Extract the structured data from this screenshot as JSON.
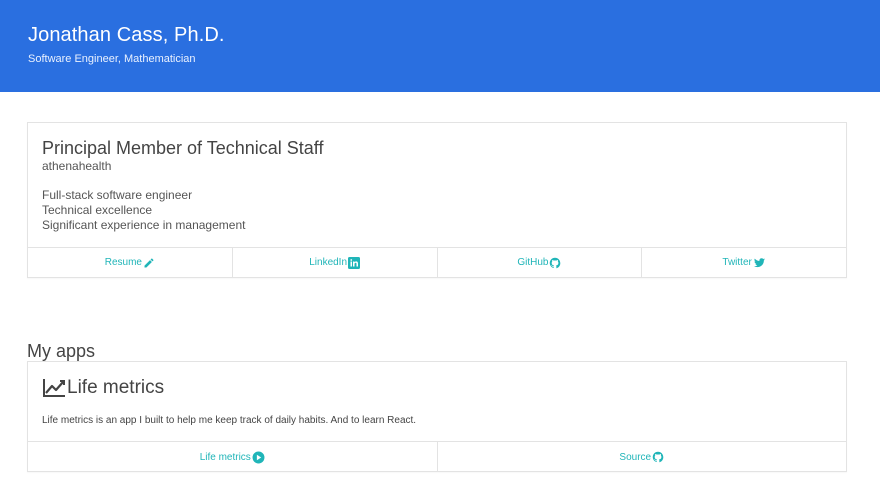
{
  "header": {
    "name": "Jonathan Cass, Ph.D.",
    "subtitle": "Software Engineer, Mathematician",
    "background": "#2a6fe0"
  },
  "job": {
    "title": "Principal Member of Technical Staff",
    "company": "athenahealth",
    "points": [
      "Full-stack software engineer",
      "Technical excellence",
      "Significant experience in management"
    ],
    "links": [
      {
        "label": "Resume",
        "icon": "pencil-icon"
      },
      {
        "label": "LinkedIn",
        "icon": "linkedin-icon"
      },
      {
        "label": "GitHub",
        "icon": "github-icon"
      },
      {
        "label": "Twitter",
        "icon": "twitter-icon"
      }
    ]
  },
  "apps": {
    "section_title": "My apps",
    "items": [
      {
        "title": "Life metrics",
        "icon": "line-chart-icon",
        "description": "Life metrics is an app I built to help me keep track of daily habits. And to learn React.",
        "links": [
          {
            "label": "Life metrics",
            "icon": "play-circle-icon"
          },
          {
            "label": "Source",
            "icon": "github-icon"
          }
        ]
      }
    ]
  },
  "colors": {
    "accent": "#20b5b8",
    "border": "#e3e3e3"
  }
}
